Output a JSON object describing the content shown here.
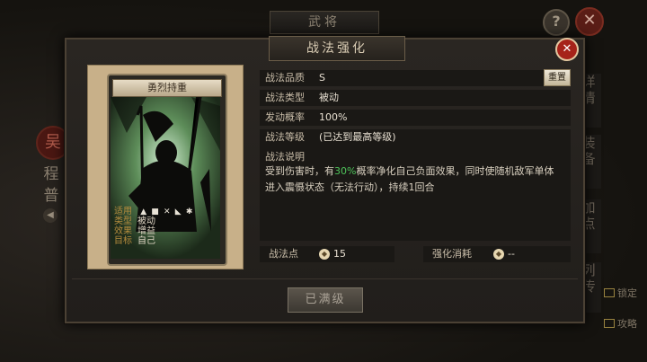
{
  "background": {
    "title": "武将",
    "help_label": "?",
    "close_label": "✕",
    "char_badge": "吴",
    "hero_name": "程普",
    "side_tabs": [
      "详情",
      "装备",
      "加点",
      "列传"
    ],
    "right_links": [
      "锁定",
      "攻略"
    ]
  },
  "dialog": {
    "title": "战法强化",
    "close_label": "✕"
  },
  "card": {
    "title": "勇烈持重",
    "stats": [
      {
        "key": "适用",
        "value": ""
      },
      {
        "key": "类型",
        "value": "被动"
      },
      {
        "key": "效果",
        "value": "增益"
      },
      {
        "key": "目标",
        "value": "自己"
      }
    ]
  },
  "info": {
    "quality_key": "战法品质",
    "quality_val": "S",
    "reset_label": "重置",
    "type_key": "战法类型",
    "type_val": "被动",
    "prob_key": "发动概率",
    "prob_val": "100%",
    "level_key": "战法等级",
    "level_val": "(已达到最高等级)",
    "desc_title": "战法说明",
    "desc_pre": "受到伤害时，有",
    "desc_highlight": "30%",
    "desc_post": "概率净化自己负面效果，同时使随机敌军单体进入震慑状态（无法行动），持续1回合",
    "points_key": "战法点",
    "points_val": "15",
    "cost_key": "强化消耗",
    "cost_val": "--"
  },
  "maxed_label": "已满级",
  "colors": {
    "accent_green": "#4ec25a",
    "close_red": "#a6231a",
    "card_frame": "#c8b089"
  }
}
